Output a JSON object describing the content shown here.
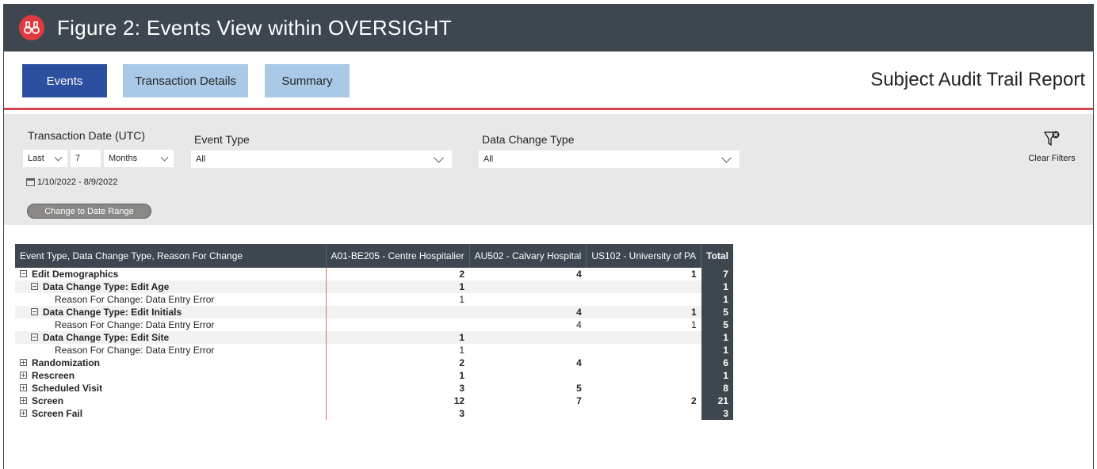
{
  "header": {
    "title": "Figure 2: Events View within OVERSIGHT"
  },
  "tabs": [
    {
      "label": "Events",
      "active": true
    },
    {
      "label": "Transaction Details",
      "active": false
    },
    {
      "label": "Summary",
      "active": false
    }
  ],
  "report_title": "Subject Audit Trail Report",
  "filters": {
    "transaction_date": {
      "label": "Transaction Date (UTC)",
      "relative": "Last",
      "amount": "7",
      "unit": "Months",
      "range": "1/10/2022 - 8/9/2022",
      "change_button": "Change to Date Range"
    },
    "event_type": {
      "label": "Event Type",
      "value": "All"
    },
    "data_change_type": {
      "label": "Data Change Type",
      "value": "All"
    },
    "clear_filters": "Clear Filters"
  },
  "matrix": {
    "columns": [
      "Event Type, Data Change Type, Reason For Change",
      "A01-BE205 - Centre Hospitalier",
      "AU502 - Calvary Hospital",
      "US102 - University of PA",
      "Total"
    ],
    "rows": [
      {
        "level": 1,
        "toggle": "minus",
        "label": "Edit Demographics",
        "c1": "2",
        "c2": "4",
        "c3": "1",
        "total": "7"
      },
      {
        "level": 2,
        "toggle": "minus",
        "label": "Data Change Type: Edit Age",
        "c1": "1",
        "c2": "",
        "c3": "",
        "total": "1"
      },
      {
        "level": 3,
        "toggle": "",
        "label": "Reason For Change: Data Entry Error",
        "c1": "1",
        "c2": "",
        "c3": "",
        "total": "1"
      },
      {
        "level": 2,
        "toggle": "minus",
        "label": "Data Change Type: Edit Initials",
        "c1": "",
        "c2": "4",
        "c3": "1",
        "total": "5"
      },
      {
        "level": 3,
        "toggle": "",
        "label": "Reason For Change: Data Entry Error",
        "c1": "",
        "c2": "4",
        "c3": "1",
        "total": "5"
      },
      {
        "level": 2,
        "toggle": "minus",
        "label": "Data Change Type: Edit Site",
        "c1": "1",
        "c2": "",
        "c3": "",
        "total": "1"
      },
      {
        "level": 3,
        "toggle": "",
        "label": "Reason For Change: Data Entry Error",
        "c1": "1",
        "c2": "",
        "c3": "",
        "total": "1"
      },
      {
        "level": 1,
        "toggle": "plus",
        "label": "Randomization",
        "c1": "2",
        "c2": "4",
        "c3": "",
        "total": "6"
      },
      {
        "level": 1,
        "toggle": "plus",
        "label": "Rescreen",
        "c1": "1",
        "c2": "",
        "c3": "",
        "total": "1"
      },
      {
        "level": 1,
        "toggle": "plus",
        "label": "Scheduled Visit",
        "c1": "3",
        "c2": "5",
        "c3": "",
        "total": "8"
      },
      {
        "level": 1,
        "toggle": "plus",
        "label": "Screen",
        "c1": "12",
        "c2": "7",
        "c3": "2",
        "total": "21"
      },
      {
        "level": 1,
        "toggle": "plus",
        "label": "Screen Fail",
        "c1": "3",
        "c2": "",
        "c3": "",
        "total": "3"
      }
    ]
  },
  "colors": {
    "header_bg": "#3e474f",
    "accent_red": "#d64550",
    "tab_active": "#2d4fa0",
    "tab_inactive": "#a9c9e6"
  }
}
